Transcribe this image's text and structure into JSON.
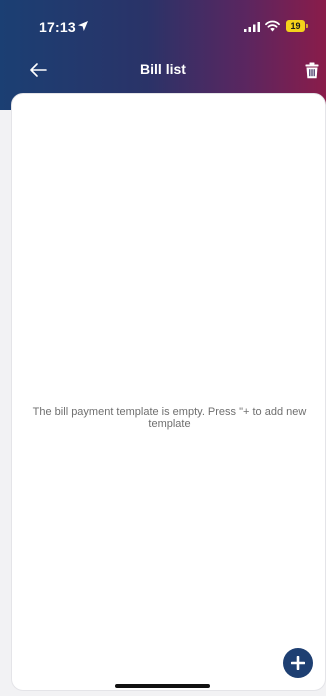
{
  "status_bar": {
    "time": "17:13",
    "battery_level": "19",
    "icons": [
      "location-arrow-icon",
      "signal-icon",
      "wifi-icon",
      "battery-icon"
    ]
  },
  "header": {
    "title": "Bill list",
    "back_icon": "arrow-left-icon",
    "delete_icon": "trash-icon"
  },
  "main": {
    "empty_message": "The bill payment template is empty. Press \"+ to add new template"
  },
  "fab": {
    "icon": "plus-icon"
  },
  "colors": {
    "header_gradient_start": "#1b3f73",
    "header_gradient_end": "#8a1c4a",
    "battery": "#f4d21b",
    "fab": "#1e3f72",
    "message_text": "#6f6f6f"
  }
}
